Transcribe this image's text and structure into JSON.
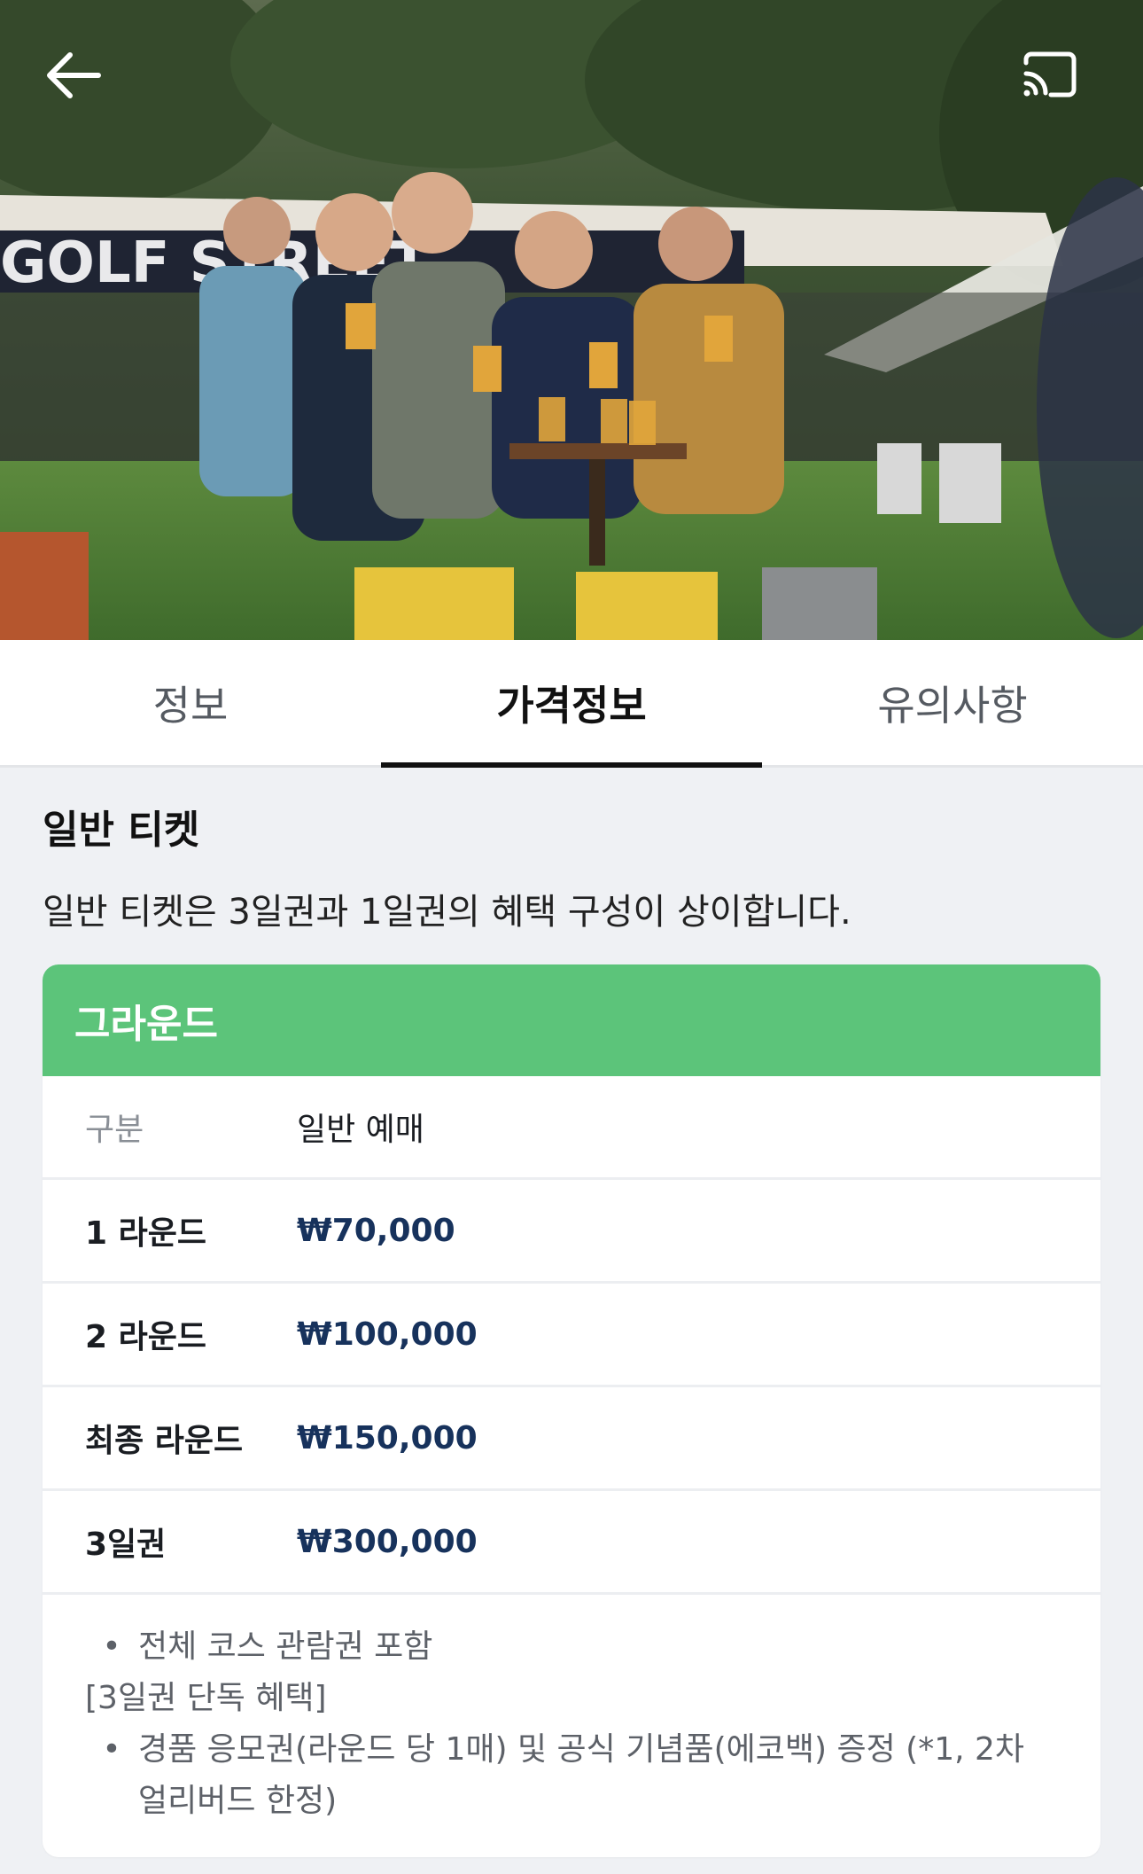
{
  "header": {
    "back_icon": "arrow-left-icon",
    "cast_icon": "cast-icon"
  },
  "hero": {
    "banner_text": "GOLF STREET"
  },
  "tabs": [
    {
      "label": "정보",
      "active": false
    },
    {
      "label": "가격정보",
      "active": true
    },
    {
      "label": "유의사항",
      "active": false
    }
  ],
  "section": {
    "title": "일반 티켓",
    "description": "일반 티켓은 3일권과 1일권의 혜택 구성이 상이합니다."
  },
  "card": {
    "header": "그라운드",
    "header_color": "#5cc47a",
    "column_headers": {
      "label": "구분",
      "value": "일반 예매"
    },
    "rows": [
      {
        "label": "1 라운드",
        "price": "₩70,000"
      },
      {
        "label": "2 라운드",
        "price": "₩100,000"
      },
      {
        "label": "최종 라운드",
        "price": "₩150,000"
      },
      {
        "label": "3일권",
        "price": "₩300,000"
      }
    ],
    "notes": {
      "bullet1": "전체 코스 관람권 포함",
      "subheading": "[3일권 단독 혜택]",
      "bullet2": "경품 응모권(라운드 당 1매) 및 공식 기념품(에코백) 증정 (*1, 2차 얼리버드 한정)"
    }
  }
}
